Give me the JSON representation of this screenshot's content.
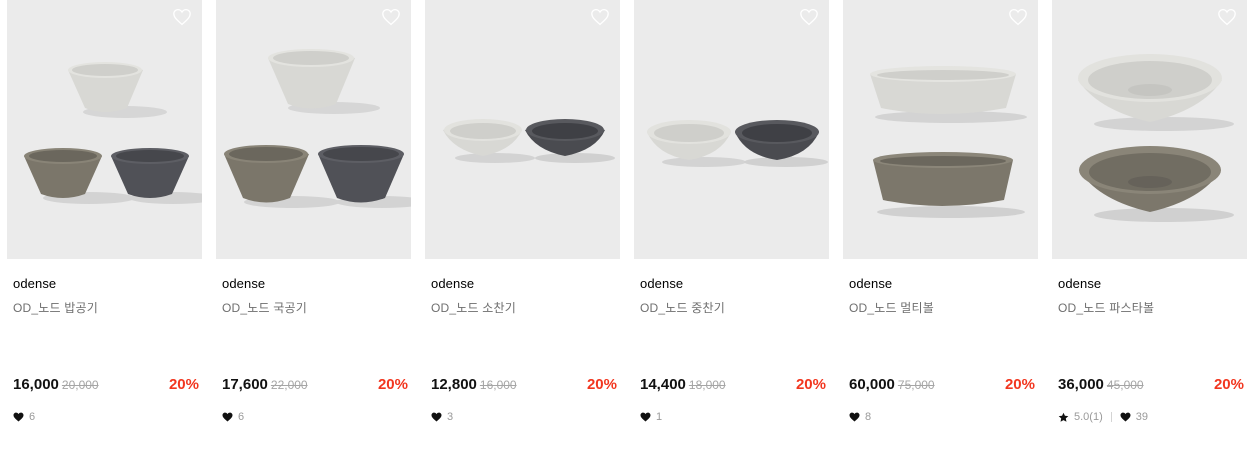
{
  "products": [
    {
      "brand": "odense",
      "name": "OD_노드 밥공기",
      "price": "16,000",
      "original_price": "20,000",
      "discount": "20%",
      "likes": "6",
      "rating": ""
    },
    {
      "brand": "odense",
      "name": "OD_노드 국공기",
      "price": "17,600",
      "original_price": "22,000",
      "discount": "20%",
      "likes": "6",
      "rating": ""
    },
    {
      "brand": "odense",
      "name": "OD_노드 소찬기",
      "price": "12,800",
      "original_price": "16,000",
      "discount": "20%",
      "likes": "3",
      "rating": ""
    },
    {
      "brand": "odense",
      "name": "OD_노드 중찬기",
      "price": "14,400",
      "original_price": "18,000",
      "discount": "20%",
      "likes": "1",
      "rating": ""
    },
    {
      "brand": "odense",
      "name": "OD_노드 멀티볼",
      "price": "60,000",
      "original_price": "75,000",
      "discount": "20%",
      "likes": "8",
      "rating": ""
    },
    {
      "brand": "odense",
      "name": "OD_노드 파스타볼",
      "price": "36,000",
      "original_price": "45,000",
      "discount": "20%",
      "likes": "39",
      "rating": "5.0(1)"
    }
  ],
  "colors": {
    "discount": "#f2361f",
    "thumb_bg": "#ebebeb",
    "bowl_light": "#d9d9d6",
    "bowl_olive": "#7a7568",
    "bowl_charcoal": "#4f5055"
  },
  "icons": {
    "wishlist": "heart-outline-icon",
    "likes": "heart-filled-icon",
    "rating": "star-filled-icon"
  }
}
